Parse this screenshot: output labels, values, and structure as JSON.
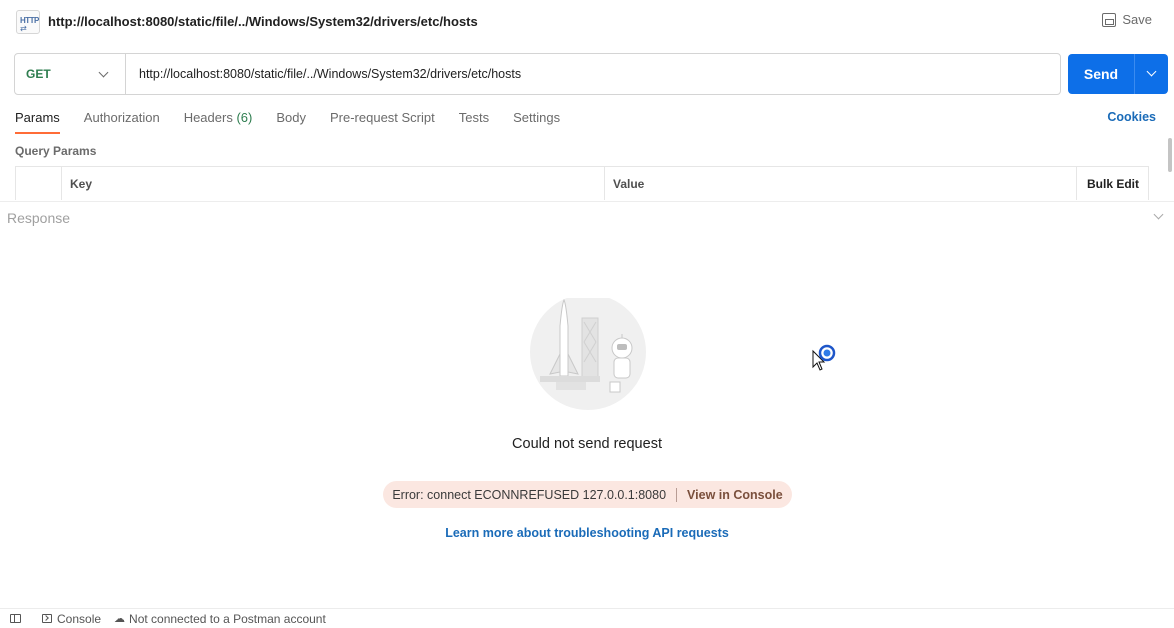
{
  "titlebar": {
    "badge_text": "HTTP",
    "title": "http://localhost:8080/static/file/../Windows/System32/drivers/etc/hosts",
    "save_label": "Save"
  },
  "request": {
    "method": "GET",
    "url": "http://localhost:8080/static/file/../Windows/System32/drivers/etc/hosts",
    "send_label": "Send"
  },
  "tabs": [
    {
      "label": "Params",
      "count": ""
    },
    {
      "label": "Authorization",
      "count": ""
    },
    {
      "label": "Headers",
      "count": "(6)"
    },
    {
      "label": "Body",
      "count": ""
    },
    {
      "label": "Pre-request Script",
      "count": ""
    },
    {
      "label": "Tests",
      "count": ""
    },
    {
      "label": "Settings",
      "count": ""
    }
  ],
  "cookies_label": "Cookies",
  "params": {
    "section_label": "Query Params",
    "col_key": "Key",
    "col_value": "Value",
    "bulk_edit": "Bulk Edit"
  },
  "response": {
    "label": "Response",
    "error_title": "Could not send request",
    "error_message": "Error: connect ECONNREFUSED 127.0.0.1:8080",
    "view_console": "View in Console",
    "learn_more": "Learn more about troubleshooting API requests"
  },
  "statusbar": {
    "console": "Console",
    "account": "Not connected to a Postman account"
  },
  "colors": {
    "accent": "#ff6c37",
    "send": "#0d6fe8",
    "link": "#1a6bb8",
    "method_get": "#2e7d4f",
    "error_bg": "#fbe7e1"
  }
}
